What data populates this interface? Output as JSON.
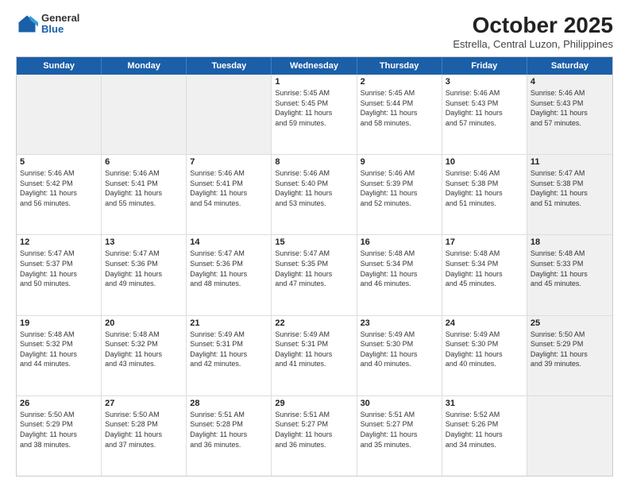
{
  "header": {
    "logo_general": "General",
    "logo_blue": "Blue",
    "month_title": "October 2025",
    "location": "Estrella, Central Luzon, Philippines"
  },
  "days_of_week": [
    "Sunday",
    "Monday",
    "Tuesday",
    "Wednesday",
    "Thursday",
    "Friday",
    "Saturday"
  ],
  "rows": [
    {
      "cells": [
        {
          "day": "",
          "content": "",
          "shaded": true
        },
        {
          "day": "",
          "content": "",
          "shaded": true
        },
        {
          "day": "",
          "content": "",
          "shaded": true
        },
        {
          "day": "1",
          "content": "Sunrise: 5:45 AM\nSunset: 5:45 PM\nDaylight: 11 hours\nand 59 minutes."
        },
        {
          "day": "2",
          "content": "Sunrise: 5:45 AM\nSunset: 5:44 PM\nDaylight: 11 hours\nand 58 minutes."
        },
        {
          "day": "3",
          "content": "Sunrise: 5:46 AM\nSunset: 5:43 PM\nDaylight: 11 hours\nand 57 minutes."
        },
        {
          "day": "4",
          "content": "Sunrise: 5:46 AM\nSunset: 5:43 PM\nDaylight: 11 hours\nand 57 minutes.",
          "shaded": true
        }
      ]
    },
    {
      "cells": [
        {
          "day": "5",
          "content": "Sunrise: 5:46 AM\nSunset: 5:42 PM\nDaylight: 11 hours\nand 56 minutes."
        },
        {
          "day": "6",
          "content": "Sunrise: 5:46 AM\nSunset: 5:41 PM\nDaylight: 11 hours\nand 55 minutes."
        },
        {
          "day": "7",
          "content": "Sunrise: 5:46 AM\nSunset: 5:41 PM\nDaylight: 11 hours\nand 54 minutes."
        },
        {
          "day": "8",
          "content": "Sunrise: 5:46 AM\nSunset: 5:40 PM\nDaylight: 11 hours\nand 53 minutes."
        },
        {
          "day": "9",
          "content": "Sunrise: 5:46 AM\nSunset: 5:39 PM\nDaylight: 11 hours\nand 52 minutes."
        },
        {
          "day": "10",
          "content": "Sunrise: 5:46 AM\nSunset: 5:38 PM\nDaylight: 11 hours\nand 51 minutes."
        },
        {
          "day": "11",
          "content": "Sunrise: 5:47 AM\nSunset: 5:38 PM\nDaylight: 11 hours\nand 51 minutes.",
          "shaded": true
        }
      ]
    },
    {
      "cells": [
        {
          "day": "12",
          "content": "Sunrise: 5:47 AM\nSunset: 5:37 PM\nDaylight: 11 hours\nand 50 minutes."
        },
        {
          "day": "13",
          "content": "Sunrise: 5:47 AM\nSunset: 5:36 PM\nDaylight: 11 hours\nand 49 minutes."
        },
        {
          "day": "14",
          "content": "Sunrise: 5:47 AM\nSunset: 5:36 PM\nDaylight: 11 hours\nand 48 minutes."
        },
        {
          "day": "15",
          "content": "Sunrise: 5:47 AM\nSunset: 5:35 PM\nDaylight: 11 hours\nand 47 minutes."
        },
        {
          "day": "16",
          "content": "Sunrise: 5:48 AM\nSunset: 5:34 PM\nDaylight: 11 hours\nand 46 minutes."
        },
        {
          "day": "17",
          "content": "Sunrise: 5:48 AM\nSunset: 5:34 PM\nDaylight: 11 hours\nand 45 minutes."
        },
        {
          "day": "18",
          "content": "Sunrise: 5:48 AM\nSunset: 5:33 PM\nDaylight: 11 hours\nand 45 minutes.",
          "shaded": true
        }
      ]
    },
    {
      "cells": [
        {
          "day": "19",
          "content": "Sunrise: 5:48 AM\nSunset: 5:32 PM\nDaylight: 11 hours\nand 44 minutes."
        },
        {
          "day": "20",
          "content": "Sunrise: 5:48 AM\nSunset: 5:32 PM\nDaylight: 11 hours\nand 43 minutes."
        },
        {
          "day": "21",
          "content": "Sunrise: 5:49 AM\nSunset: 5:31 PM\nDaylight: 11 hours\nand 42 minutes."
        },
        {
          "day": "22",
          "content": "Sunrise: 5:49 AM\nSunset: 5:31 PM\nDaylight: 11 hours\nand 41 minutes."
        },
        {
          "day": "23",
          "content": "Sunrise: 5:49 AM\nSunset: 5:30 PM\nDaylight: 11 hours\nand 40 minutes."
        },
        {
          "day": "24",
          "content": "Sunrise: 5:49 AM\nSunset: 5:30 PM\nDaylight: 11 hours\nand 40 minutes."
        },
        {
          "day": "25",
          "content": "Sunrise: 5:50 AM\nSunset: 5:29 PM\nDaylight: 11 hours\nand 39 minutes.",
          "shaded": true
        }
      ]
    },
    {
      "cells": [
        {
          "day": "26",
          "content": "Sunrise: 5:50 AM\nSunset: 5:29 PM\nDaylight: 11 hours\nand 38 minutes."
        },
        {
          "day": "27",
          "content": "Sunrise: 5:50 AM\nSunset: 5:28 PM\nDaylight: 11 hours\nand 37 minutes."
        },
        {
          "day": "28",
          "content": "Sunrise: 5:51 AM\nSunset: 5:28 PM\nDaylight: 11 hours\nand 36 minutes."
        },
        {
          "day": "29",
          "content": "Sunrise: 5:51 AM\nSunset: 5:27 PM\nDaylight: 11 hours\nand 36 minutes."
        },
        {
          "day": "30",
          "content": "Sunrise: 5:51 AM\nSunset: 5:27 PM\nDaylight: 11 hours\nand 35 minutes."
        },
        {
          "day": "31",
          "content": "Sunrise: 5:52 AM\nSunset: 5:26 PM\nDaylight: 11 hours\nand 34 minutes."
        },
        {
          "day": "",
          "content": "",
          "shaded": true
        }
      ]
    }
  ]
}
